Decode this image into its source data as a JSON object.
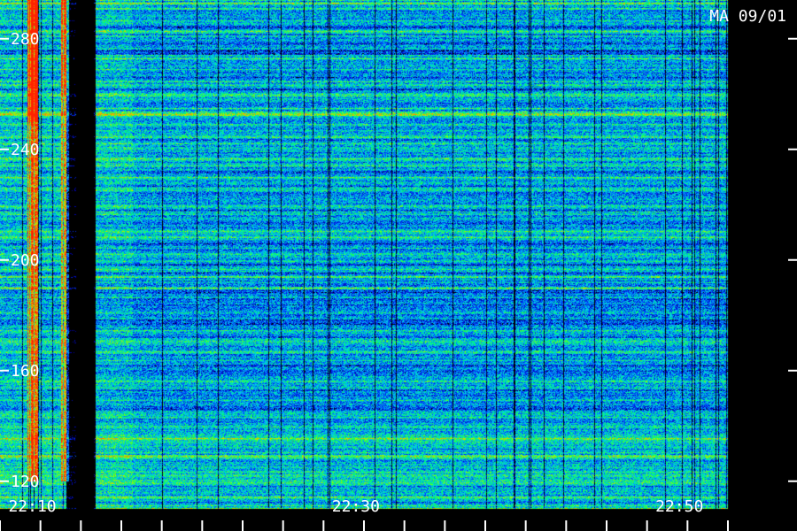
{
  "chart_data": {
    "type": "heatmap",
    "title": "MA 09/01",
    "xlabel": "",
    "ylabel": "",
    "x_ticks": [
      "22:10",
      "22:30",
      "22:50"
    ],
    "y_ticks": [
      120,
      160,
      200,
      240,
      280
    ],
    "ylim": [
      110,
      294
    ],
    "xlim": [
      "22:08",
      "22:53"
    ],
    "colormap": [
      "#000000",
      "#0000aa",
      "#0044ff",
      "#00ccee",
      "#00ff66",
      "#bbee00",
      "#ff8800",
      "#ff2200"
    ],
    "features": [
      {
        "time": "22:10",
        "intensity": "high",
        "freq_range": [
          120,
          294
        ]
      },
      {
        "time": "22:12",
        "intensity": "medium",
        "freq_range": [
          120,
          294
        ]
      },
      {
        "time": "22:13",
        "intensity": "low",
        "freq_range": [
          110,
          294
        ]
      }
    ]
  }
}
